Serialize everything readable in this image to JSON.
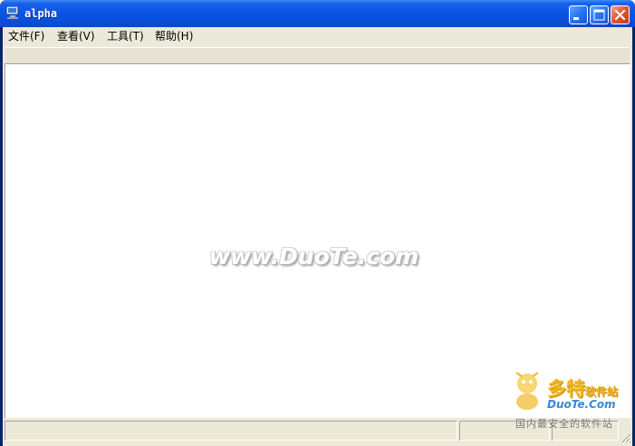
{
  "window": {
    "title": "alpha",
    "app_icon": "computer-icon",
    "controls": {
      "minimize": "minimize-icon",
      "maximize": "maximize-icon",
      "close": "close-icon"
    }
  },
  "menu": {
    "items": [
      {
        "label": "文件(F)"
      },
      {
        "label": "查看(V)"
      },
      {
        "label": "工具(T)"
      },
      {
        "label": "帮助(H)"
      }
    ]
  },
  "client": {
    "watermark": "www.DuoTe.com"
  },
  "brand": {
    "name": "多特",
    "name_suffix": "软件站",
    "url": "DuoTe.Com",
    "tagline": "国内最安全的软件站",
    "mascot": "mascot-icon"
  },
  "statusbar": {
    "panes": [
      "",
      "",
      ""
    ]
  },
  "colors": {
    "titlebar": "#0a55e6",
    "frame": "#ece9d8",
    "client": "#ffffff",
    "close_button": "#e35a36",
    "brand_orange": "#f3b91f",
    "brand_blue": "#3c86d8"
  }
}
